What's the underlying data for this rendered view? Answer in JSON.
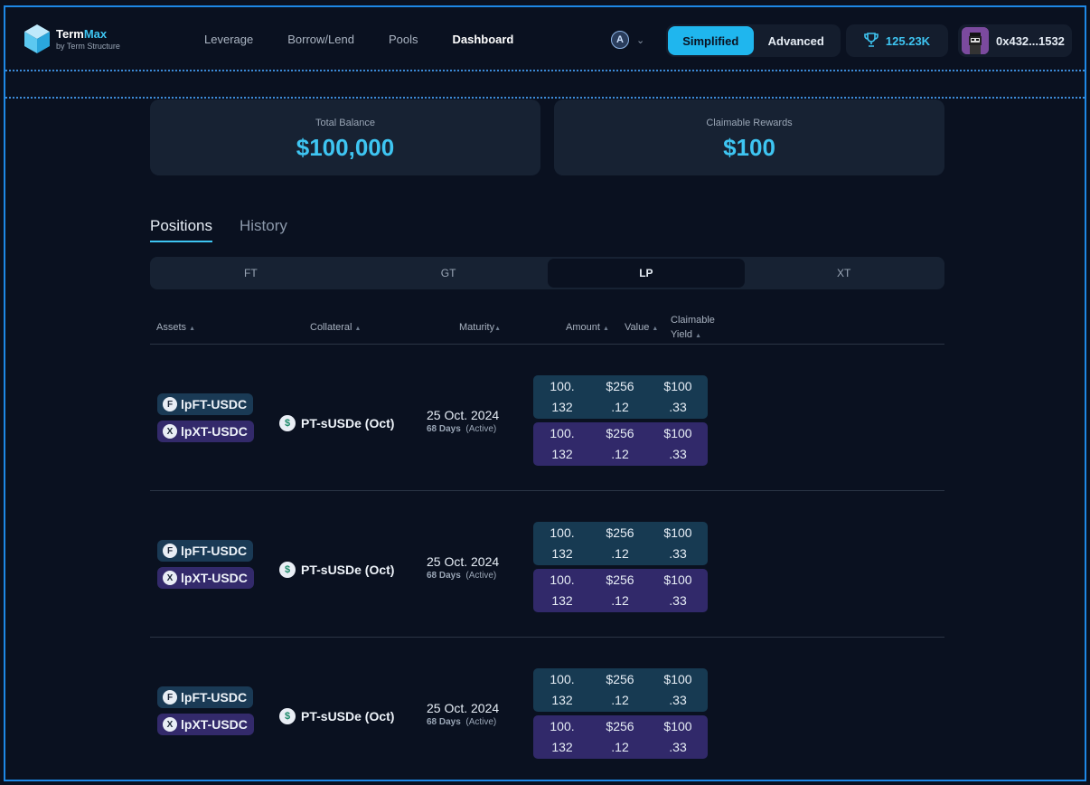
{
  "header": {
    "logo_name": "Term",
    "logo_name_accent": "Max",
    "logo_sub": "by Term Structure",
    "nav": [
      "Leverage",
      "Borrow/Lend",
      "Pools",
      "Dashboard"
    ],
    "active_nav": "Dashboard",
    "chain_icon": "arbitrum-icon",
    "mode": {
      "simplified": "Simplified",
      "advanced": "Advanced",
      "selected": "Simplified"
    },
    "points": "125.23K",
    "points_icon": "trophy-icon",
    "wallet_address": "0x432...1532"
  },
  "balances": {
    "total_label": "Total Balance",
    "total_value": "$100,000",
    "rewards_label": "Claimable Rewards",
    "rewards_value": "$100"
  },
  "tabs": {
    "positions": "Positions",
    "history": "History",
    "selected": "Positions"
  },
  "segments": {
    "items": [
      "FT",
      "GT",
      "LP",
      "XT"
    ],
    "selected": "LP"
  },
  "table": {
    "headers": {
      "assets": "Assets",
      "collateral": "Collateral",
      "maturity": "Maturity",
      "amount": "Amount",
      "value": "Value",
      "yield_line1": "Claimable",
      "yield_line2": "Yield"
    },
    "rows": [
      {
        "ft_token": "lpFT-USDC",
        "xt_token": "lpXT-USDC",
        "collateral": "PT-sUSDe (Oct)",
        "maturity_date": "25 Oct. 2024",
        "days": "68 Days",
        "status": "(Active)",
        "ft_values": {
          "amount": [
            "100.",
            "132"
          ],
          "value": [
            "$256",
            ".12"
          ],
          "yield": [
            "$100",
            ".33"
          ]
        },
        "xt_values": {
          "amount": [
            "100.",
            "132"
          ],
          "value": [
            "$256",
            ".12"
          ],
          "yield": [
            "$100",
            ".33"
          ]
        }
      },
      {
        "ft_token": "lpFT-USDC",
        "xt_token": "lpXT-USDC",
        "collateral": "PT-sUSDe (Oct)",
        "maturity_date": "25 Oct. 2024",
        "days": "68 Days",
        "status": "(Active)",
        "ft_values": {
          "amount": [
            "100.",
            "132"
          ],
          "value": [
            "$256",
            ".12"
          ],
          "yield": [
            "$100",
            ".33"
          ]
        },
        "xt_values": {
          "amount": [
            "100.",
            "132"
          ],
          "value": [
            "$256",
            ".12"
          ],
          "yield": [
            "$100",
            ".33"
          ]
        }
      },
      {
        "ft_token": "lpFT-USDC",
        "xt_token": "lpXT-USDC",
        "collateral": "PT-sUSDe (Oct)",
        "maturity_date": "25 Oct. 2024",
        "days": "68 Days",
        "status": "(Active)",
        "ft_values": {
          "amount": [
            "100.",
            "132"
          ],
          "value": [
            "$256",
            ".12"
          ],
          "yield": [
            "$100",
            ".33"
          ]
        },
        "xt_values": {
          "amount": [
            "100.",
            "132"
          ],
          "value": [
            "$256",
            ".12"
          ],
          "yield": [
            "$100",
            ".33"
          ]
        }
      }
    ]
  },
  "colors": {
    "accent": "#3ec5f2",
    "background": "#0a1120",
    "ft_fill": "#173a52",
    "xt_fill": "#31296a"
  }
}
